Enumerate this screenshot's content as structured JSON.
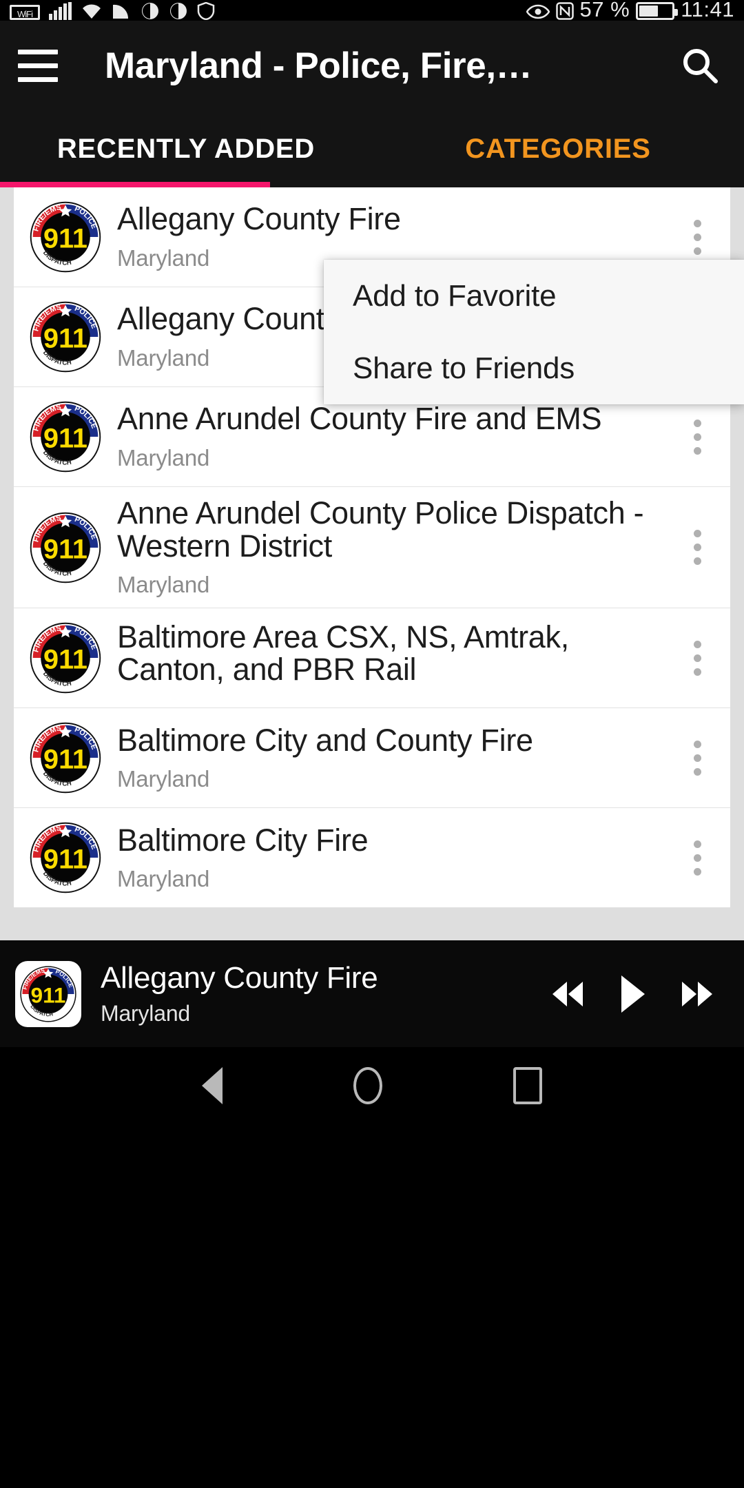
{
  "status_bar": {
    "wifi_label": "WiFi",
    "battery_percent": "57 %",
    "time": "11:41",
    "icons": [
      "wifi-hd-icon",
      "signal-bars-icon",
      "wifi-icon",
      "cast-icon",
      "sync-icon",
      "sync-alt-icon",
      "shield-icon",
      "eye-icon",
      "nfc-icon",
      "battery-icon"
    ]
  },
  "app_bar": {
    "menu_icon": "hamburger-menu-icon",
    "title": "Maryland - Police, Fire,…",
    "search_icon": "search-icon"
  },
  "tabs": [
    {
      "label": "RECENTLY ADDED",
      "active": true
    },
    {
      "label": "CATEGORIES",
      "active": false
    }
  ],
  "colors": {
    "tab_active_text": "#ffffff",
    "tab_inactive_text": "#f2951f",
    "tab_indicator": "#f5166b",
    "appbar_bg": "#141414",
    "list_bg": "#dedede",
    "player_bg": "#0a0a0a"
  },
  "list": {
    "items": [
      {
        "title": "Allegany County Fire",
        "subtitle": "Maryland",
        "logo": "911-dispatch-badge-icon"
      },
      {
        "title": "Allegany County EMS Dispatch",
        "subtitle": "Maryland",
        "logo": "911-dispatch-badge-icon"
      },
      {
        "title": "Anne Arundel County Fire and EMS",
        "subtitle": "Maryland",
        "logo": "911-dispatch-badge-icon"
      },
      {
        "title": "Anne Arundel County Police Dispatch - Western District",
        "subtitle": "Maryland",
        "logo": "911-dispatch-badge-icon"
      },
      {
        "title": "Baltimore Area CSX, NS, Amtrak, Canton, and PBR Rail",
        "subtitle": "",
        "logo": "911-dispatch-badge-icon"
      },
      {
        "title": "Baltimore City and County Fire",
        "subtitle": "Maryland",
        "logo": "911-dispatch-badge-icon"
      },
      {
        "title": "Baltimore City Fire",
        "subtitle": "Maryland",
        "logo": "911-dispatch-badge-icon"
      }
    ]
  },
  "popup_menu": {
    "items": [
      {
        "label": "Add to Favorite"
      },
      {
        "label": "Share to Friends"
      }
    ]
  },
  "player": {
    "logo": "911-dispatch-badge-icon",
    "title": "Allegany County Fire",
    "subtitle": "Maryland",
    "controls": [
      {
        "name": "rewind-button",
        "glyph": "rewind-icon"
      },
      {
        "name": "play-button",
        "glyph": "play-icon"
      },
      {
        "name": "fast-forward-button",
        "glyph": "fast-forward-icon"
      }
    ]
  },
  "nav_bar": {
    "back": "back-triangle-icon",
    "home": "home-circle-icon",
    "recents": "recents-square-icon"
  },
  "badge_text": {
    "top_left": "FIRE/EMS",
    "top_right": "POLICE",
    "center": "911",
    "bottom": "DISPATCH"
  }
}
